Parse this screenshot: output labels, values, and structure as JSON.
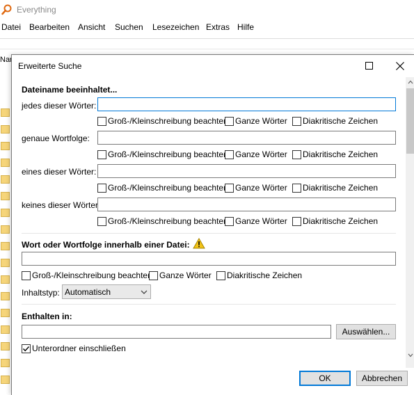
{
  "app": {
    "title": "Everything",
    "menu": [
      "Datei",
      "Bearbeiten",
      "Ansicht",
      "Suchen",
      "Lesezeichen",
      "Extras",
      "Hilfe"
    ],
    "column_header_fragment": "Nam"
  },
  "dialog": {
    "title": "Erweiterte Suche",
    "filename_section": {
      "heading": "Dateiname beeinhaltet...",
      "rows": [
        {
          "label": "jedes dieser Wörter:",
          "value": "",
          "case": "Groß-/Kleinschreibung beachten",
          "whole": "Ganze Wörter",
          "diacritics": "Diakritische Zeichen"
        },
        {
          "label": "genaue Wortfolge:",
          "value": "",
          "case": "Groß-/Kleinschreibung beachten",
          "whole": "Ganze Wörter",
          "diacritics": "Diakritische Zeichen"
        },
        {
          "label": "eines dieser Wörter:",
          "value": "",
          "case": "Groß-/Kleinschreibung beachten",
          "whole": "Ganze Wörter",
          "diacritics": "Diakritische Zeichen"
        },
        {
          "label": "keines dieser Wörter:",
          "value": "",
          "case": "Groß-/Kleinschreibung beachten",
          "whole": "Ganze Wörter",
          "diacritics": "Diakritische Zeichen"
        }
      ]
    },
    "content_section": {
      "heading": "Wort oder Wortfolge innerhalb einer Datei:",
      "value": "",
      "case": "Groß-/Kleinschreibung beachten",
      "whole": "Ganze Wörter",
      "diacritics": "Diakritische Zeichen",
      "content_type_label": "Inhaltstyp:",
      "content_type_value": "Automatisch"
    },
    "location_section": {
      "heading": "Enthalten in:",
      "value": "",
      "browse_button": "Auswählen...",
      "subfolders_label": "Unterordner einschließen",
      "subfolders_checked": true
    },
    "ok_button": "OK",
    "cancel_button": "Abbrechen"
  },
  "colors": {
    "focus_border": "#0078d7",
    "warning": "#f2c318",
    "folder": "#f6d57a"
  }
}
